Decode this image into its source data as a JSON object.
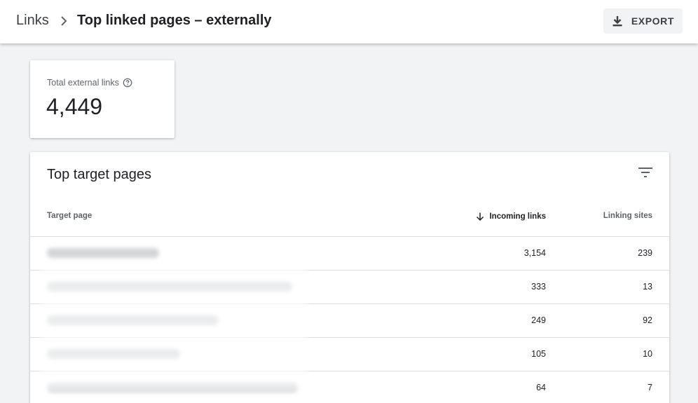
{
  "header": {
    "breadcrumb_root": "Links",
    "page_title": "Top linked pages – externally",
    "export_label": "EXPORT"
  },
  "summary": {
    "label": "Total external links",
    "value": "4,449"
  },
  "table": {
    "title": "Top target pages",
    "columns": {
      "target": "Target page",
      "incoming": "Incoming links",
      "linking": "Linking sites"
    },
    "sorted_by": "incoming",
    "sort_direction": "descending",
    "rows": [
      {
        "incoming": "3,154",
        "linking": "239"
      },
      {
        "incoming": "333",
        "linking": "13"
      },
      {
        "incoming": "249",
        "linking": "92"
      },
      {
        "incoming": "105",
        "linking": "10"
      },
      {
        "incoming": "64",
        "linking": "7"
      }
    ]
  },
  "icons": {
    "breadcrumb_separator": "chevron-right-icon",
    "export": "download-icon",
    "help": "help-circle-icon",
    "filter": "filter-list-icon",
    "sort": "arrow-down-icon"
  },
  "colors": {
    "header_bg": "#ffffff",
    "page_bg": "#f1f3f4",
    "text_primary": "#202124",
    "text_secondary": "#5f6368",
    "divider": "#dadce0"
  }
}
